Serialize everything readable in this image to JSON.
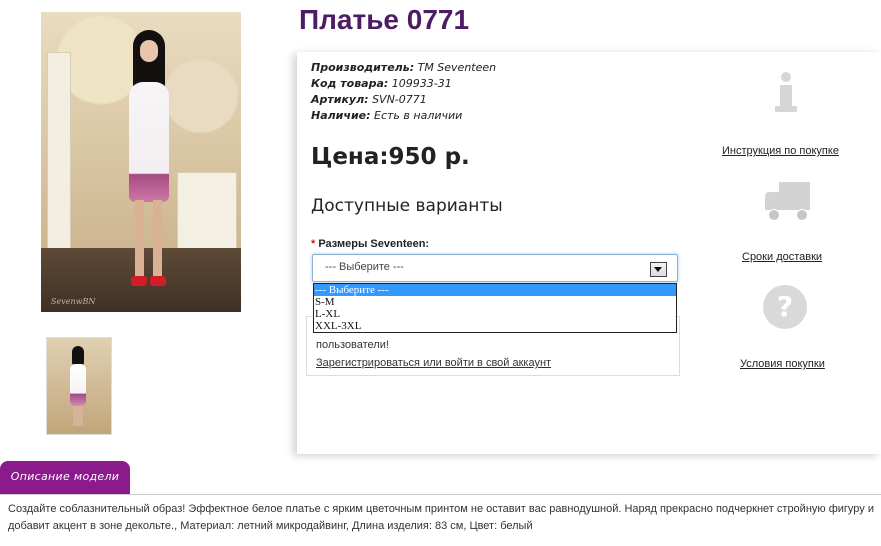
{
  "product": {
    "title": "Платье 0771",
    "meta": {
      "manufacturer_label": "Производитель:",
      "manufacturer_value": "TM Seventeen",
      "code_label": "Код товара:",
      "code_value": "109933-31",
      "sku_label": "Артикул:",
      "sku_value": "SVN-0771",
      "availability_label": "Наличие:",
      "availability_value": "Есть в наличии"
    },
    "price": "Цена:950 р.",
    "variants_heading": "Доступные варианты",
    "size_label": "Размеры Seventeen:",
    "select": {
      "value": "--- Выберите ---",
      "options": [
        "--- Выберите ---",
        "S-M",
        "L-XL",
        "XXL-3XL"
      ]
    },
    "login": {
      "message": "пользователи!",
      "link": "Зарегистрироваться или войти в свой аккаунт"
    },
    "photo_signature": "SevenwBN"
  },
  "side_links": {
    "purchase_instruction": "Инструкция по покупке",
    "delivery_terms": "Сроки доставки",
    "purchase_conditions": "Условия покупки"
  },
  "tabs": {
    "description_tab": "Описание модели"
  },
  "description": "Создайте соблазнительный образ! Эффектное белое платье с ярким цветочным принтом не оставит вас равнодушной. Наряд прекрасно подчеркнет стройную фигуру и добавит акцент в зоне декольте., Материал: летний микродайвинг, Длина изделия: 83 см, Цвет: белый",
  "colors": {
    "title": "#4d1c65",
    "tab_bg": "#8b1a8c",
    "option_highlight": "#3399ff",
    "required_star": "#dd1111"
  },
  "icons": [
    "info-icon",
    "truck-icon",
    "question-icon",
    "dropdown-arrow-icon"
  ]
}
